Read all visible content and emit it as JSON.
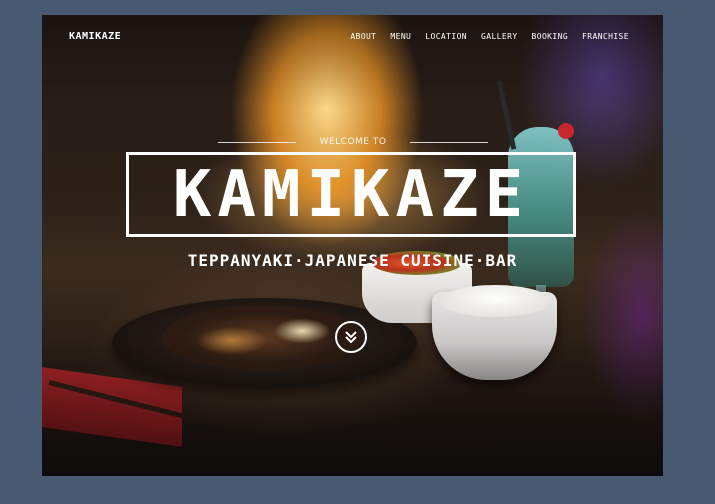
{
  "brand": "KAMIKAZE",
  "nav": {
    "items": [
      {
        "label": "ABOUT"
      },
      {
        "label": "MENU"
      },
      {
        "label": "LOCATION"
      },
      {
        "label": "GALLERY"
      },
      {
        "label": "BOOKING"
      },
      {
        "label": "FRANCHISE"
      }
    ]
  },
  "hero": {
    "welcome": "WELCOME TO",
    "title": "KAMIKAZE",
    "subtitle": "TEPPANYAKI·JAPANESE CUISINE·BAR",
    "scroll_icon": "double-chevron-down-icon"
  },
  "colors": {
    "page_bg": "#485a72",
    "text": "#ffffff"
  }
}
